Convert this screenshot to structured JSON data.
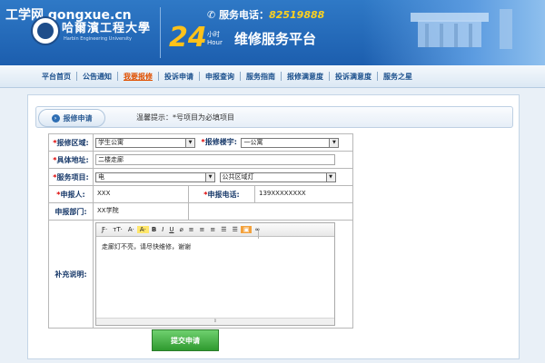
{
  "header": {
    "watermark_prefix": "工学网",
    "watermark_domain": "gongxue.cn",
    "university_name": "哈爾濱工程大學",
    "university_en": "Harbin Engineering University",
    "service_phone_label": "服务电话：",
    "service_phone_number": "82519888",
    "hours_big": "24",
    "hours_unit_top": "小时",
    "hours_unit_bottom": "Hour",
    "platform_title": "维修服务平台"
  },
  "nav": {
    "items": [
      {
        "label": "平台首页"
      },
      {
        "label": "公告通知"
      },
      {
        "label": "我要报修",
        "active": true
      },
      {
        "label": "投诉申请"
      },
      {
        "label": "申报查询"
      },
      {
        "label": "服务指南"
      },
      {
        "label": "报修满意度"
      },
      {
        "label": "投诉满意度"
      },
      {
        "label": "服务之星"
      }
    ]
  },
  "tab": {
    "label": "报修申请"
  },
  "tip": "温馨提示：*号项目为必填项目",
  "form": {
    "area_label": "报修区域:",
    "area_value": "学生公寓",
    "building_label": "报修楼宇:",
    "building_value": "一公寓",
    "address_label": "具体地址:",
    "address_value": "二楼走廊",
    "item_label": "服务项目:",
    "item_value": "电",
    "subitem_value": "公共区域灯",
    "reporter_label": "申报人:",
    "reporter_value": "XXX",
    "phone_label": "申报电话:",
    "phone_value": "139XXXXXXXX",
    "dept_label": "申报部门:",
    "dept_value": "XX学院",
    "notes_label": "补充说明:",
    "notes_value": "走廊灯不亮，请尽快维修，谢谢",
    "required_mark": "*",
    "submit_label": "提交申请"
  },
  "editor_toolbar": {
    "font_family": "Ƒ·",
    "font_size": "тT·",
    "font_color": "A·",
    "highlight": "A·",
    "bold": "B",
    "italic": "I",
    "underline": "U",
    "erase": "⌀",
    "align_left": "≡",
    "align_center": "≡",
    "align_right": "≡",
    "ordered_list": "☰",
    "unordered_list": "☰",
    "image": "▣",
    "link": "∞"
  }
}
